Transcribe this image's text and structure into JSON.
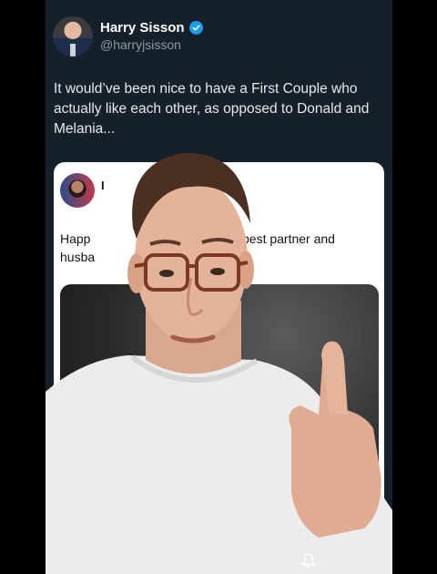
{
  "tweet": {
    "display_name": "Harry Sisson",
    "handle": "@harryjsisson",
    "verified": true,
    "text": "It would’ve been nice to have a First Couple who actually like each other, as opposed to Donald and Melania..."
  },
  "quoted": {
    "name_fragment": "I",
    "text_left": "Happ",
    "text_right": "best partner and",
    "text_left2": "husba"
  },
  "icons": {
    "verified": "verified-badge-icon",
    "notification": "bell-icon"
  },
  "colors": {
    "background": "#15202b",
    "accent": "#1d9bf0",
    "card": "#ffffff"
  }
}
